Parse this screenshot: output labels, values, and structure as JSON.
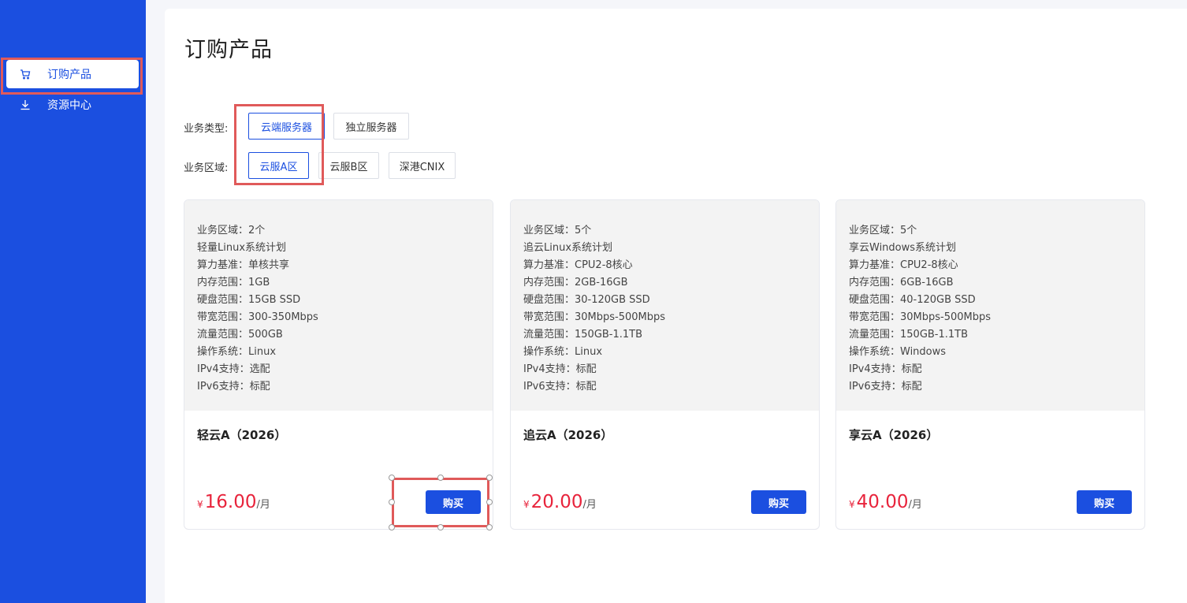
{
  "sidebar": {
    "items": [
      {
        "label": "订购产品",
        "icon": "cart-icon",
        "active": true
      },
      {
        "label": "资源中心",
        "icon": "download-icon",
        "active": false
      }
    ]
  },
  "page": {
    "title": "订购产品"
  },
  "filters": {
    "business_type": {
      "label": "业务类型:",
      "options": [
        "云端服务器",
        "独立服务器"
      ],
      "selected": "云端服务器"
    },
    "business_region": {
      "label": "业务区域:",
      "options": [
        "云服A区",
        "云服B区",
        "深港CNIX"
      ],
      "selected": "云服A区"
    }
  },
  "products": [
    {
      "specs": [
        "业务区域：2个",
        "轻量Linux系统计划",
        "算力基准：单核共享",
        "内存范围：1GB",
        "硬盘范围：15GB SSD",
        "带宽范围：300-350Mbps",
        "流量范围：500GB",
        "操作系统：Linux",
        "IPv4支持：选配",
        "IPv6支持：标配"
      ],
      "name": "轻云A（2026）",
      "currency": "¥",
      "price": "16.00",
      "unit": "/月",
      "buy_label": "购买"
    },
    {
      "specs": [
        "业务区域：5个",
        "追云Linux系统计划",
        "算力基准：CPU2-8核心",
        "内存范围：2GB-16GB",
        "硬盘范围：30-120GB SSD",
        "带宽范围：30Mbps-500Mbps",
        "流量范围：150GB-1.1TB",
        "操作系统：Linux",
        "IPv4支持：标配",
        "IPv6支持：标配"
      ],
      "name": "追云A（2026）",
      "currency": "¥",
      "price": "20.00",
      "unit": "/月",
      "buy_label": "购买"
    },
    {
      "specs": [
        "业务区域：5个",
        "享云Windows系统计划",
        "算力基准：CPU2-8核心",
        "内存范围：6GB-16GB",
        "硬盘范围：40-120GB SSD",
        "带宽范围：30Mbps-500Mbps",
        "流量范围：150GB-1.1TB",
        "操作系统：Windows",
        "IPv4支持：标配",
        "IPv6支持：标配"
      ],
      "name": "享云A（2026）",
      "currency": "¥",
      "price": "40.00",
      "unit": "/月",
      "buy_label": "购买"
    }
  ],
  "colors": {
    "accent": "#1b4fe0",
    "price": "#e8243c",
    "annotation": "#e05a5a"
  }
}
